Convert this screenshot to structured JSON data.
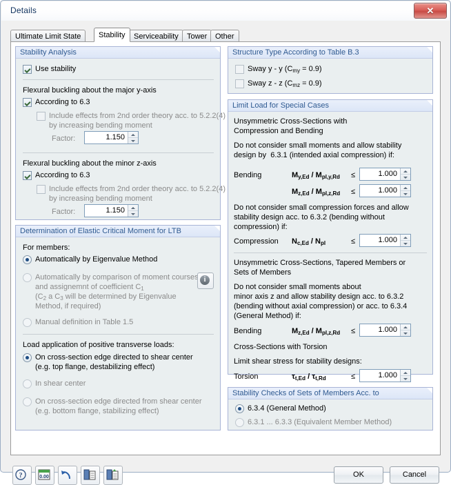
{
  "window": {
    "title": "Details",
    "close_label": "✕"
  },
  "tabs": [
    {
      "label": "Ultimate Limit State",
      "active": false
    },
    {
      "label": "Stability",
      "active": true
    },
    {
      "label": "Serviceability",
      "active": false
    },
    {
      "label": "Tower",
      "active": false
    },
    {
      "label": "Other",
      "active": false
    }
  ],
  "left": {
    "stability_analysis": {
      "title": "Stability Analysis",
      "use_stability": {
        "label": "Use stability",
        "checked": true
      },
      "major_y": {
        "heading": "Flexural buckling about the major y-axis",
        "according": {
          "label": "According to 6.3",
          "checked": true
        },
        "include": {
          "line1": "Include effects from 2nd order theory acc. to 5.2.2(4)",
          "line2": "by increasing bending moment",
          "checked": false
        },
        "factor_label": "Factor:",
        "factor_value": "1.150"
      },
      "minor_z": {
        "heading": "Flexural buckling about the minor z-axis",
        "according": {
          "label": "According to 6.3",
          "checked": true
        },
        "include": {
          "line1": "Include effects from 2nd order theory acc. to 5.2.2(4)",
          "line2": "by increasing bending moment",
          "checked": false
        },
        "factor_label": "Factor:",
        "factor_value": "1.150"
      }
    },
    "ltb": {
      "title": "Determination of Elastic Critical Moment for LTB",
      "for_members_label": "For members:",
      "options": [
        {
          "label": "Automatically by Eigenvalue Method",
          "selected": true
        },
        {
          "label": "Automatically by comparison of moment courses",
          "line2": "and assignemnt of coefficient C",
          "sub2": "1",
          "line3a": "(C",
          "sub3a": "2",
          "line3b": " a C",
          "sub3b": "3",
          "line3c": " will be determined by Eigenvalue",
          "line4": "Method, if required)",
          "selected": false
        },
        {
          "label": "Manual definition in Table 1.5",
          "selected": false
        }
      ],
      "info_glyph": "i",
      "load_app_label": "Load application of positive transverse loads:",
      "load_options": [
        {
          "line1": "On cross-section edge directed to shear center",
          "line2": "(e.g. top flange, destabilizing effect)",
          "selected": true
        },
        {
          "line1": "In shear center",
          "line2": "",
          "selected": false
        },
        {
          "line1": "On cross-section edge directed from shear center",
          "line2": "(e.g. bottom flange, stabilizing effect)",
          "selected": false
        }
      ]
    }
  },
  "right": {
    "structure_type": {
      "title": "Structure Type According to Table B.3",
      "items": [
        {
          "pre": "Sway y - y (C",
          "sub": "my",
          "post": " = 0.9)",
          "checked": false
        },
        {
          "pre": "Sway z - z (C",
          "sub": "mz",
          "post": " = 0.9)",
          "checked": false
        }
      ]
    },
    "limit_load": {
      "title": "Limit Load for Special Cases",
      "block1_head1": "Unsymmetric Cross-Sections with",
      "block1_head2": "Compression and Bending",
      "block1_text1": "Do not consider small moments and allow stability",
      "block1_text2": "design by  6.3.1 (intended axial compression) if:",
      "bending_label": "Bending",
      "row1_formula": "My,Ed / Mpl,y,Rd",
      "row1_op": "≤",
      "row1_value": "1.000",
      "row2_formula": "Mz,Ed / Mpl,z,Rd",
      "row2_op": "≤",
      "row2_value": "1.000",
      "block2_text1": "Do not consider small compression forces and allow",
      "block2_text2": "stability design acc. to 6.3.2 (bending without",
      "block2_text3": "compression) if:",
      "compression_label": "Compression",
      "row3_formula": "Nc,Ed / Npl",
      "row3_op": "≤",
      "row3_value": "1.000",
      "block3_head1": "Unsymmetric Cross-Sections, Tapered Members or",
      "block3_head2": "Sets of Members",
      "block3_text1": "Do not consider small moments about",
      "block3_text2": "minor axis z and allow stability design acc. to 6.3.2",
      "block3_text3": "(bending without axial compression) or acc. to 6.3.4",
      "block3_text4": "(General Method) if:",
      "bending2_label": "Bending",
      "row4_formula": "Mz,Ed / Mpl,z,Rd",
      "row4_op": "≤",
      "row4_value": "1.000",
      "torsion_head": "Cross-Sections with Torsion",
      "torsion_text": "Limit shear stress for stability designs:",
      "torsion_label": "Torsion",
      "row5_formula": "τt,Ed / τt,Rd",
      "row5_op": "≤",
      "row5_value": "1.000"
    },
    "stability_checks": {
      "title": "Stability Checks of Sets of Members Acc. to",
      "options": [
        {
          "label": "6.3.4 (General Method)",
          "selected": true
        },
        {
          "label": "6.3.1 ... 6.3.3 (Equivalent Member Method)",
          "selected": false
        }
      ]
    }
  },
  "footer": {
    "tools": [
      {
        "name": "help-icon",
        "glyph": "?"
      },
      {
        "name": "units-icon",
        "glyph": "0.00"
      },
      {
        "name": "undo-icon",
        "glyph": "↶"
      },
      {
        "name": "copy-icon",
        "glyph": "⧉"
      },
      {
        "name": "paste-icon",
        "glyph": "⧉"
      }
    ],
    "ok_label": "OK",
    "cancel_label": "Cancel"
  }
}
